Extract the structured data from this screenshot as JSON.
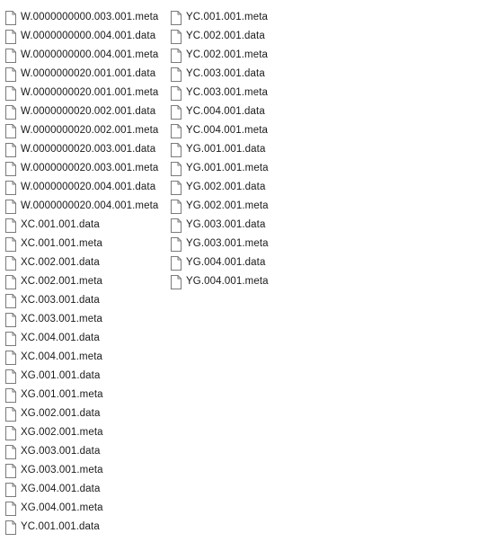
{
  "icon": "file-icon",
  "columns": [
    {
      "files": [
        "W.0000000000.003.001.meta",
        "W.0000000000.004.001.data",
        "W.0000000000.004.001.meta",
        "W.0000000020.001.001.data",
        "W.0000000020.001.001.meta",
        "W.0000000020.002.001.data",
        "W.0000000020.002.001.meta",
        "W.0000000020.003.001.data",
        "W.0000000020.003.001.meta",
        "W.0000000020.004.001.data",
        "W.0000000020.004.001.meta",
        "XC.001.001.data",
        "XC.001.001.meta",
        "XC.002.001.data",
        "XC.002.001.meta",
        "XC.003.001.data",
        "XC.003.001.meta",
        "XC.004.001.data",
        "XC.004.001.meta",
        "XG.001.001.data",
        "XG.001.001.meta",
        "XG.002.001.data",
        "XG.002.001.meta",
        "XG.003.001.data",
        "XG.003.001.meta",
        "XG.004.001.data",
        "XG.004.001.meta",
        "YC.001.001.data"
      ]
    },
    {
      "files": [
        "YC.001.001.meta",
        "YC.002.001.data",
        "YC.002.001.meta",
        "YC.003.001.data",
        "YC.003.001.meta",
        "YC.004.001.data",
        "YC.004.001.meta",
        "YG.001.001.data",
        "YG.001.001.meta",
        "YG.002.001.data",
        "YG.002.001.meta",
        "YG.003.001.data",
        "YG.003.001.meta",
        "YG.004.001.data",
        "YG.004.001.meta"
      ]
    }
  ]
}
